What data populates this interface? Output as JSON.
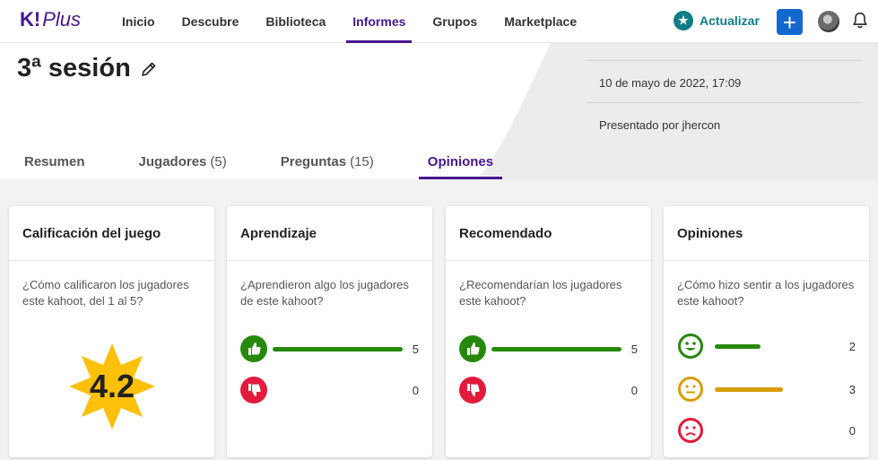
{
  "logo": {
    "k": "K!",
    "plus": "Plus"
  },
  "nav": [
    {
      "label": "Inicio",
      "active": false
    },
    {
      "label": "Descubre",
      "active": false
    },
    {
      "label": "Biblioteca",
      "active": false
    },
    {
      "label": "Informes",
      "active": true
    },
    {
      "label": "Grupos",
      "active": false
    },
    {
      "label": "Marketplace",
      "active": false
    }
  ],
  "topbar": {
    "upgrade_label": "Actualizar",
    "icons": [
      "star-icon",
      "plus-icon",
      "avatar",
      "bell-icon"
    ]
  },
  "report": {
    "title": "3ª sesión",
    "date": "10 de mayo de 2022, 17:09",
    "presented_by": "Presentado por jhercon"
  },
  "tabs": [
    {
      "label": "Resumen",
      "count": ""
    },
    {
      "label": "Jugadores",
      "count": "(5)"
    },
    {
      "label": "Preguntas",
      "count": "(15)"
    },
    {
      "label": "Opiniones",
      "count": "",
      "active": true
    }
  ],
  "cards": {
    "rating": {
      "title": "Calificación del juego",
      "question": "¿Cómo calificaron los jugadores este kahoot, del 1 al 5?",
      "score": "4.2",
      "badge_color": "#ffc00a"
    },
    "learning": {
      "title": "Aprendizaje",
      "question": "¿Aprendieron algo los jugadores de este kahoot?",
      "yes": "5",
      "no": "0",
      "yes_fraction": 1.0,
      "no_fraction": 0.0
    },
    "recommend": {
      "title": "Recomendado",
      "question": "¿Recomendarían los jugadores este kahoot?",
      "yes": "5",
      "no": "0",
      "yes_fraction": 1.0,
      "no_fraction": 0.0
    },
    "feelings": {
      "title": "Opiniones",
      "question": "¿Cómo hizo sentir a los jugadores este kahoot?",
      "positive": "2",
      "neutral": "3",
      "negative": "0",
      "positive_fraction": 0.4,
      "neutral_fraction": 0.6,
      "negative_fraction": 0.0
    }
  },
  "colors": {
    "brand": "#46178f",
    "green": "#26890c",
    "red": "#e21b3c",
    "yellow": "#d89e00",
    "teal": "#0e7e87",
    "blue": "#1368ce"
  }
}
